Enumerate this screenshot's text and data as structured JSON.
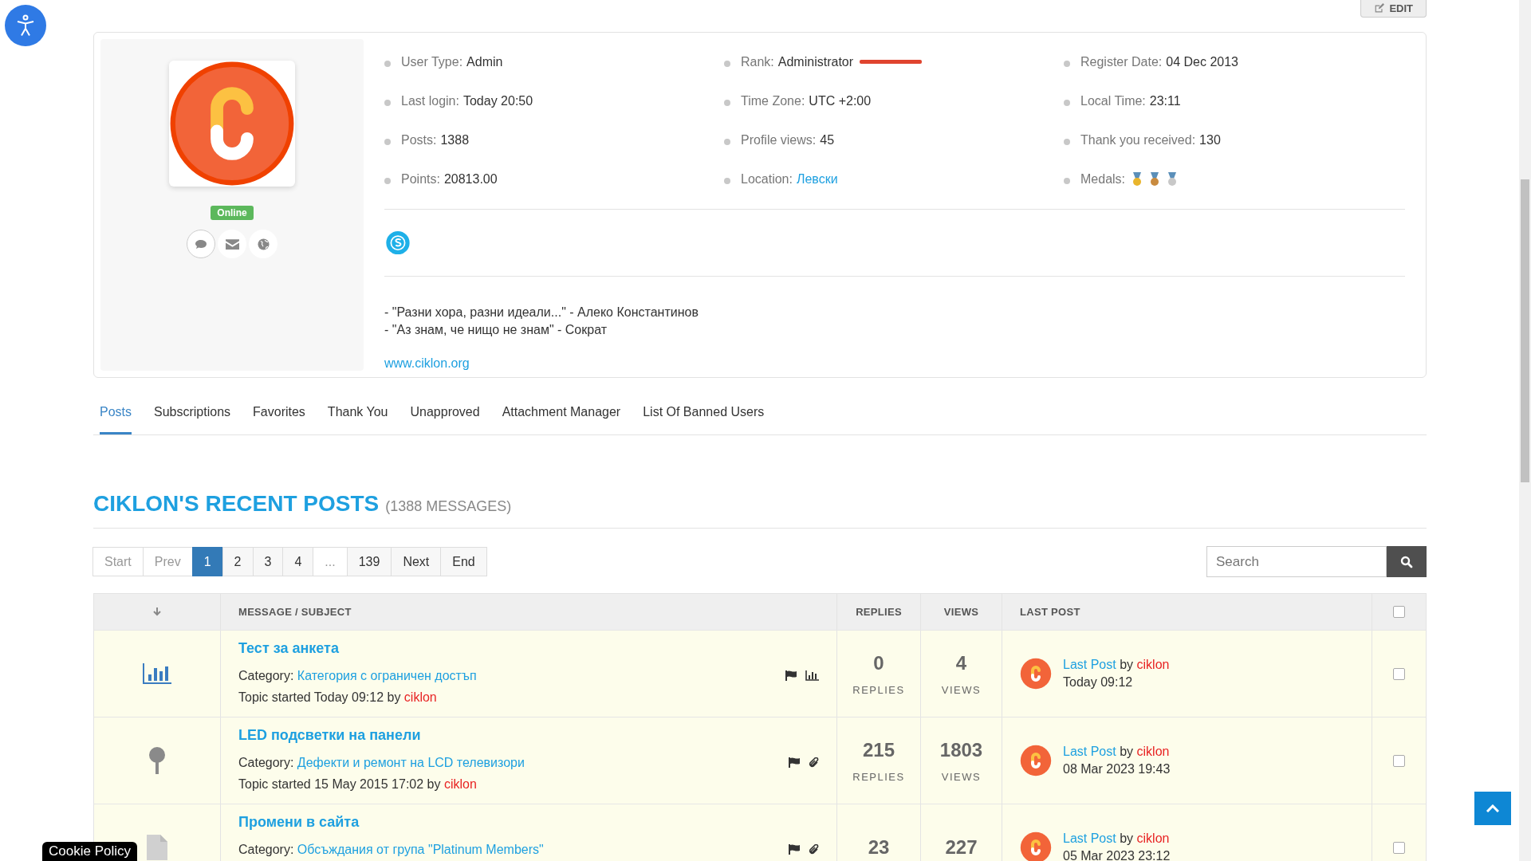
{
  "edit_button": "EDIT",
  "profile": {
    "status": "Online",
    "info": [
      {
        "label": "User Type:",
        "value": "Admin",
        "kind": "text"
      },
      {
        "label": "Rank:",
        "value": "Administrator",
        "kind": "rank"
      },
      {
        "label": "Register Date:",
        "value": "04 Dec 2013",
        "kind": "text"
      },
      {
        "label": "Last login:",
        "value": "Today 20:50",
        "kind": "text"
      },
      {
        "label": "Time Zone:",
        "value": "UTC +2:00",
        "kind": "text"
      },
      {
        "label": "Local Time:",
        "value": "23:11",
        "kind": "text"
      },
      {
        "label": "Posts:",
        "value": "1388",
        "kind": "text"
      },
      {
        "label": "Profile views:",
        "value": "45",
        "kind": "text"
      },
      {
        "label": "Thank you received:",
        "value": "130",
        "kind": "text"
      },
      {
        "label": "Points:",
        "value": "20813.00",
        "kind": "text"
      },
      {
        "label": "Location:",
        "value": "Левски",
        "kind": "link"
      },
      {
        "label": "Medals:",
        "kind": "medals",
        "medals": [
          {
            "color": "#e9b52c"
          },
          {
            "color": "#c98b3f"
          },
          {
            "color": "#c8c8c8"
          }
        ]
      }
    ],
    "bio": [
      "- \"Разни хора, разни идеали...\" - Алеко Константинов",
      "- \"Аз знам, че нищо не знам\" - Сократ"
    ],
    "website": "www.ciklon.org"
  },
  "tabs": [
    {
      "label": "Posts",
      "selected": true
    },
    {
      "label": "Subscriptions",
      "selected": false
    },
    {
      "label": "Favorites",
      "selected": false
    },
    {
      "label": "Thank You",
      "selected": false
    },
    {
      "label": "Unapproved",
      "selected": false
    },
    {
      "label": "Attachment Manager",
      "selected": false
    },
    {
      "label": "List Of Banned Users",
      "selected": false
    }
  ],
  "recent": {
    "title": "CIKLON'S RECENT POSTS",
    "count": "(1388 MESSAGES)"
  },
  "pagination": [
    {
      "label": "Start",
      "kind": "disabled"
    },
    {
      "label": "Prev",
      "kind": "disabled"
    },
    {
      "label": "1",
      "kind": "current"
    },
    {
      "label": "2",
      "kind": "page"
    },
    {
      "label": "3",
      "kind": "page"
    },
    {
      "label": "4",
      "kind": "page"
    },
    {
      "label": "...",
      "kind": "disabled"
    },
    {
      "label": "139",
      "kind": "page"
    },
    {
      "label": "Next",
      "kind": "page"
    },
    {
      "label": "End",
      "kind": "page"
    }
  ],
  "search": {
    "placeholder": "Search"
  },
  "table": {
    "columns": [
      "MESSAGE / SUBJECT",
      "REPLIES",
      "VIEWS",
      "LAST POST"
    ],
    "select_all_checked": false,
    "rows": [
      {
        "kind": "poll",
        "title": "Тест за анкета",
        "category_label": "Category:",
        "category": "Категория с ограничен достъп",
        "started": "Topic started Today 09:12 by",
        "author": "ciklon",
        "marks": [
          {
            "kind": "flag"
          },
          {
            "kind": "poll"
          }
        ],
        "replies": "0",
        "replies_label": "REPLIES",
        "views": "4",
        "views_label": "VIEWS",
        "last_link": "Last Post",
        "last_by": "by",
        "last_user": "ciklon",
        "last_time": "Today 09:12",
        "checked": false
      },
      {
        "kind": "pin",
        "title": "LED подсветки на панели",
        "category_label": "Category:",
        "category": "Дефекти и ремонт на LCD телевизори",
        "started": "Topic started 15 May 2015 17:02 by",
        "author": "ciklon",
        "marks": [
          {
            "kind": "flag"
          },
          {
            "kind": "clip"
          }
        ],
        "replies": "215",
        "replies_label": "REPLIES",
        "views": "1803",
        "views_label": "VIEWS",
        "last_link": "Last Post",
        "last_by": "by",
        "last_user": "ciklon",
        "last_time": "08 Mar 2023 19:43",
        "checked": false
      },
      {
        "kind": "file",
        "title": "Промени в сайта",
        "category_label": "Category:",
        "category": "Обсъждания от група \"Platinum Members\"",
        "marks": [
          {
            "kind": "flag"
          },
          {
            "kind": "clip"
          }
        ],
        "replies": "23",
        "views": "227",
        "last_link": "Last Post",
        "last_by": "by",
        "last_user": "ciklon",
        "last_time": "05 Mar 2023 23:12",
        "checked": false
      }
    ]
  },
  "cookie": "Cookie Policy"
}
